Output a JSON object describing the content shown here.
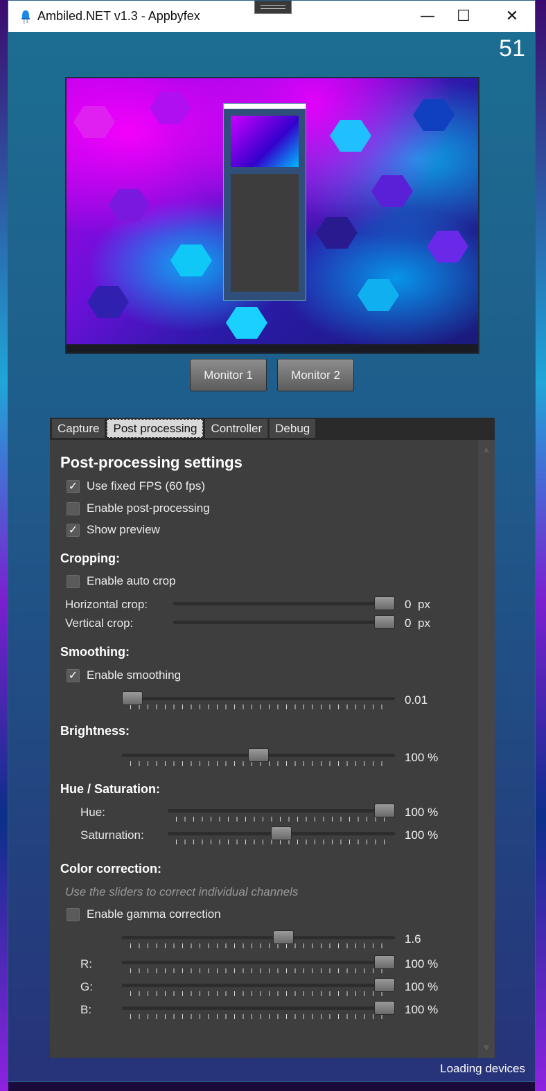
{
  "window": {
    "title": "Ambiled.NET v1.3 - Appbyfex",
    "minimize_glyph": "—",
    "maximize_glyph": "☐",
    "close_glyph": "✕",
    "fps_counter": "51"
  },
  "monitors": [
    "Monitor 1",
    "Monitor 2"
  ],
  "tabs": [
    "Capture",
    "Post processing",
    "Controller",
    "Debug"
  ],
  "active_tab": "Post processing",
  "post": {
    "heading": "Post-processing settings",
    "use_fixed_fps": {
      "label": "Use fixed FPS (60 fps)",
      "checked": true
    },
    "enable_post": {
      "label": "Enable post-processing",
      "checked": false
    },
    "show_preview": {
      "label": "Show preview",
      "checked": true
    }
  },
  "cropping": {
    "heading": "Cropping:",
    "auto_crop": {
      "label": "Enable auto crop",
      "checked": false
    },
    "horizontal": {
      "label": "Horizontal crop:",
      "value": "0",
      "unit": "px",
      "level": 1.0
    },
    "vertical": {
      "label": "Vertical crop:",
      "value": "0",
      "unit": "px",
      "level": 1.0
    }
  },
  "smoothing": {
    "heading": "Smoothing:",
    "enable": {
      "label": "Enable smoothing",
      "checked": true
    },
    "value": "0.01",
    "level": 0.0
  },
  "brightness": {
    "heading": "Brightness:",
    "value": "100 %",
    "level": 0.5
  },
  "hue_saturation": {
    "heading": "Hue / Saturation:",
    "hue": {
      "label": "Hue:",
      "value": "100 %",
      "level": 1.0
    },
    "saturation": {
      "label": "Saturnation:",
      "value": "100 %",
      "level": 0.5
    }
  },
  "color_correction": {
    "heading": "Color correction:",
    "hint": "Use the sliders to correct individual channels",
    "gamma": {
      "label": "Enable gamma correction",
      "checked": false,
      "value": "1.6",
      "level": 0.6
    },
    "r": {
      "label": "R:",
      "value": "100 %",
      "level": 1.0
    },
    "g": {
      "label": "G:",
      "value": "100 %",
      "level": 1.0
    },
    "b": {
      "label": "B:",
      "value": "100 %",
      "level": 1.0
    }
  },
  "status_text": "Loading devices",
  "checkmark_glyph": "✓",
  "scroll_up_glyph": "▲",
  "scroll_down_glyph": "▼"
}
